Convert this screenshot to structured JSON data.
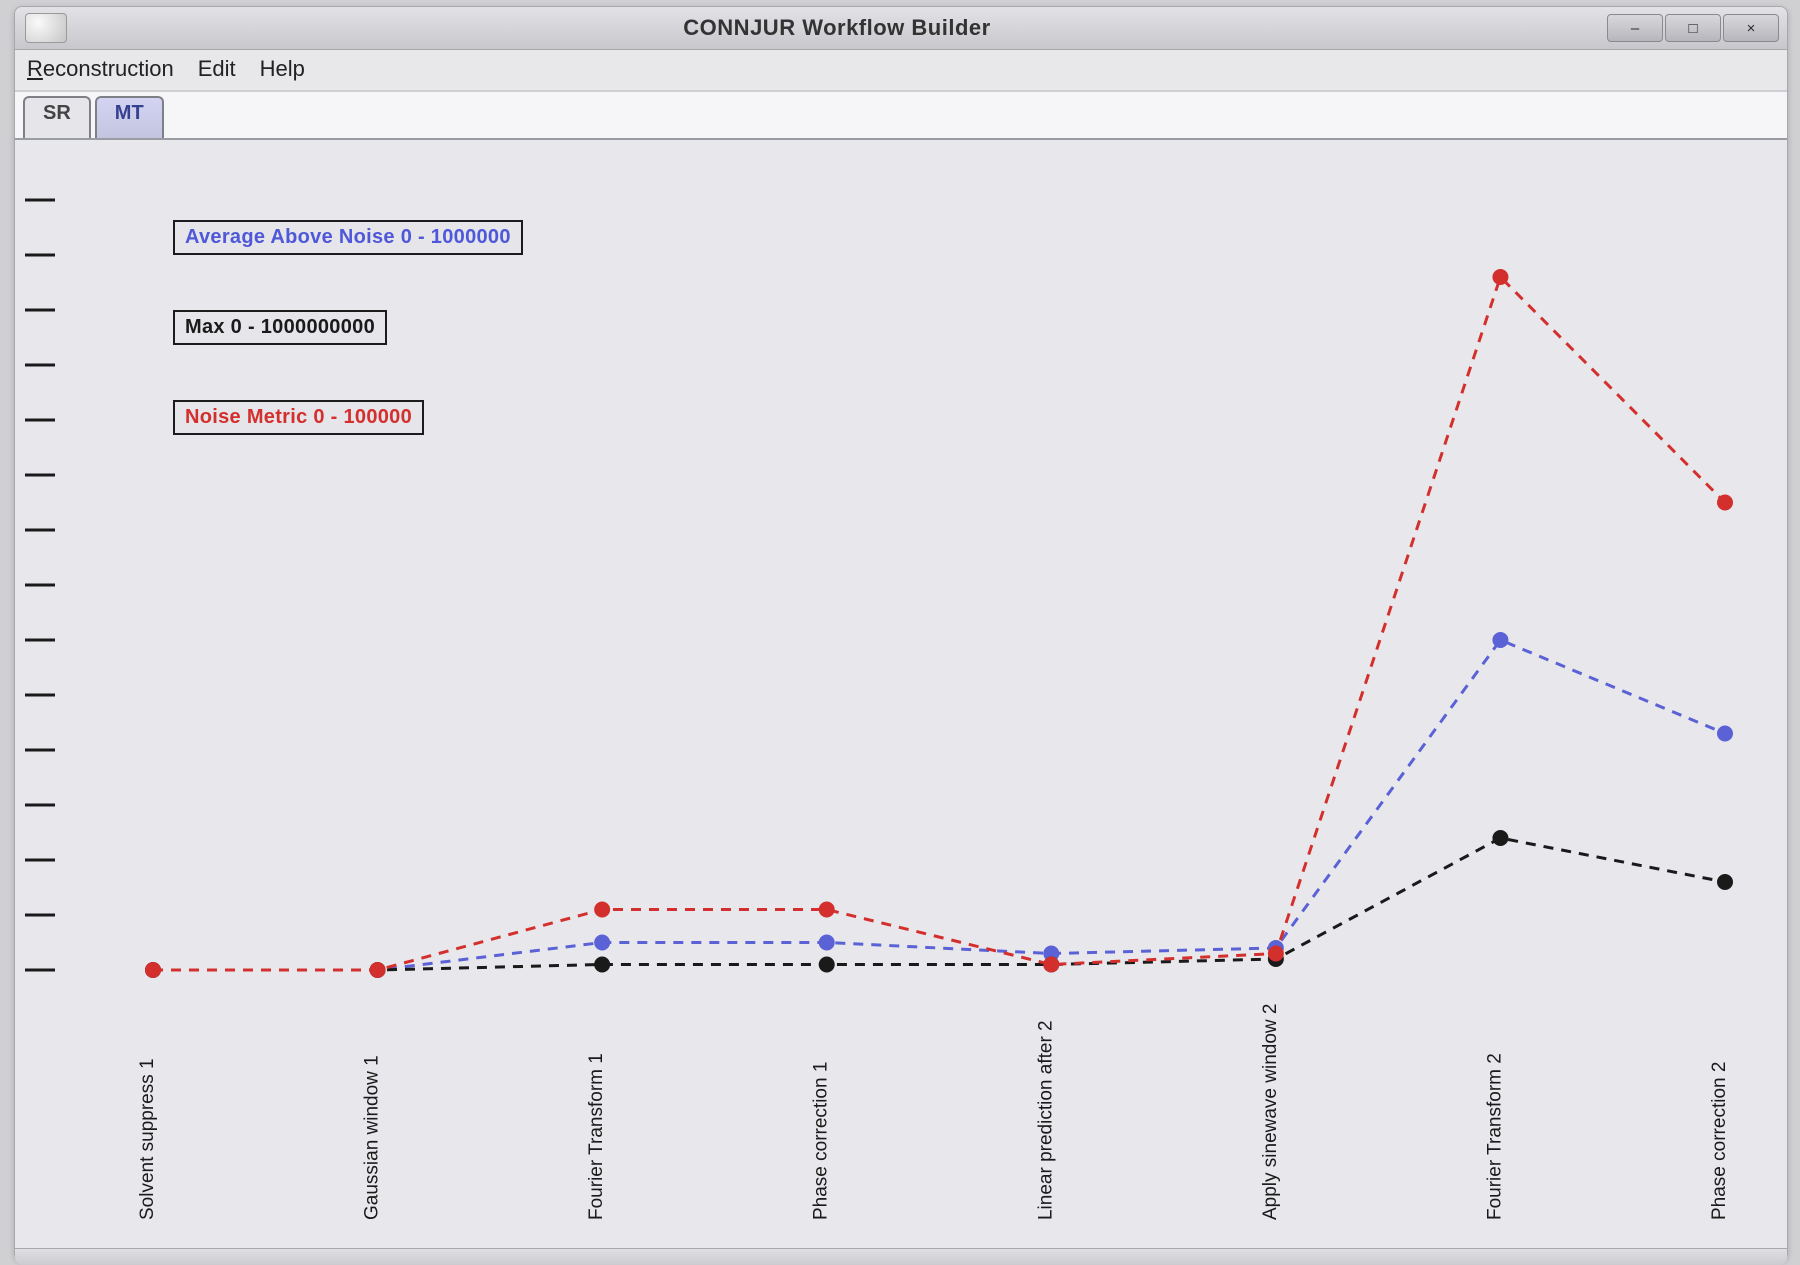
{
  "window": {
    "title": "CONNJUR Workflow Builder",
    "controls": {
      "minimize": "–",
      "maximize": "□",
      "close": "×"
    }
  },
  "menu": {
    "reconstruction": "Reconstruction",
    "edit": "Edit",
    "help": "Help"
  },
  "tabs": {
    "sr": "SR",
    "mt": "MT"
  },
  "legend": {
    "avg": "Average Above Noise 0 - 1000000",
    "max": "Max 0 - 1000000000",
    "noise": "Noise Metric 0 - 100000"
  },
  "chart_data": {
    "type": "line",
    "ylim": [
      0,
      14
    ],
    "ticks": [
      0,
      1,
      2,
      3,
      4,
      5,
      6,
      7,
      8,
      9,
      10,
      11,
      12,
      13,
      14
    ],
    "categories": [
      "Solvent suppress 1",
      "Gaussian window 1",
      "Fourier Transform 1",
      "Phase correction 1",
      "Linear prediction after 2",
      "Apply sinewave window 2",
      "Fourier Transform 2",
      "Phase correction 2"
    ],
    "series": [
      {
        "name": "Average Above Noise",
        "color_key": "blue",
        "values": [
          0.0,
          0.0,
          0.5,
          0.5,
          0.3,
          0.4,
          6.0,
          4.3
        ]
      },
      {
        "name": "Max",
        "color_key": "black",
        "values": [
          0.0,
          0.0,
          0.1,
          0.1,
          0.1,
          0.2,
          2.4,
          1.6
        ]
      },
      {
        "name": "Noise Metric",
        "color_key": "red",
        "values": [
          0.0,
          0.0,
          1.1,
          1.1,
          0.1,
          0.3,
          12.6,
          8.5
        ]
      }
    ],
    "colors": {
      "blue": "#5a62d6",
      "black": "#1a1a1a",
      "red": "#d3302d"
    }
  }
}
